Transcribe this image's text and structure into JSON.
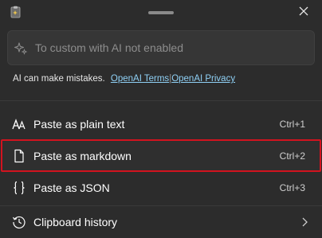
{
  "header": {
    "app_icon": "clipboard-sparkle-icon",
    "close_icon": "close-icon"
  },
  "ai_input": {
    "placeholder": "To custom with AI not enabled",
    "value": "",
    "icon": "sparkle-icon"
  },
  "disclaimer": {
    "text": "AI can make mistakes.",
    "terms_link": "OpenAI Terms",
    "separator": "|",
    "privacy_link": "OpenAI Privacy"
  },
  "menu": {
    "items": [
      {
        "label": "Paste as plain text",
        "shortcut": "Ctrl+1",
        "icon": "font-size-icon"
      },
      {
        "label": "Paste as markdown",
        "shortcut": "Ctrl+2",
        "icon": "document-icon",
        "selected": true
      },
      {
        "label": "Paste as JSON",
        "shortcut": "Ctrl+3",
        "icon": "braces-icon"
      }
    ],
    "history": {
      "label": "Clipboard history",
      "icon": "history-icon",
      "chevron": "chevron-right-icon"
    }
  },
  "colors": {
    "background": "#2c2c2c",
    "selection_outline": "#d2131f",
    "link": "#8fd0f5"
  }
}
